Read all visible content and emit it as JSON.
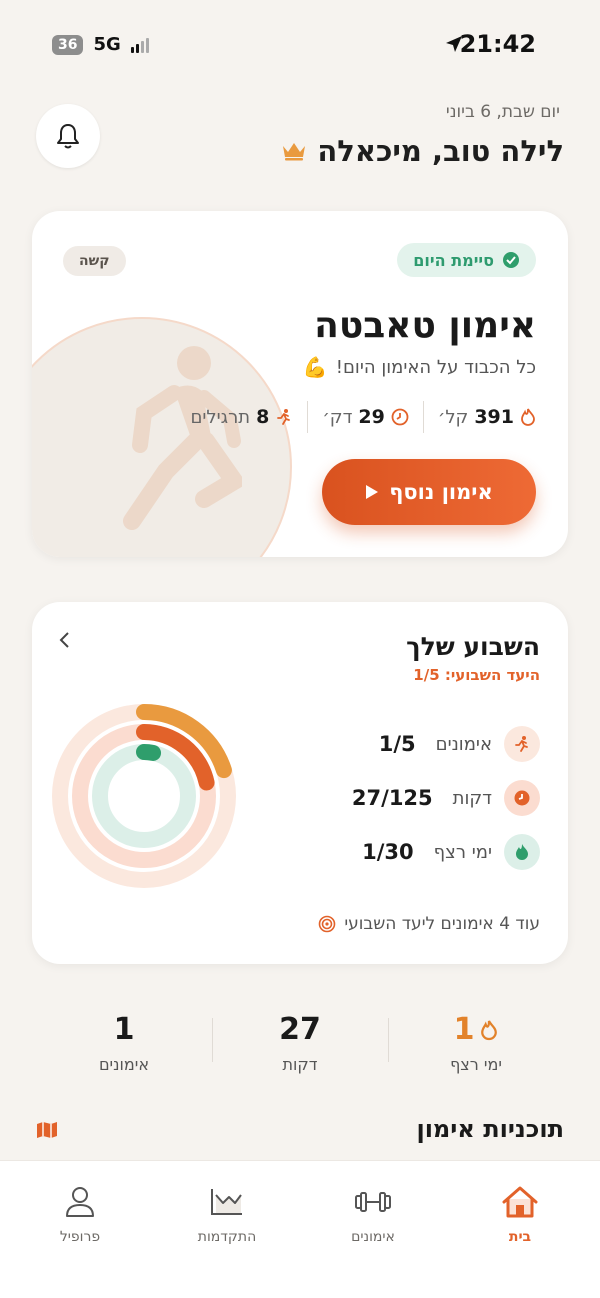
{
  "status_bar": {
    "time": "21:42",
    "network": "5G",
    "battery": "36"
  },
  "header": {
    "date": "יום שבת, 6 ביוני",
    "greeting": "לילה טוב, מיכאלה"
  },
  "workout_card": {
    "status_chip": "סיימת היום",
    "difficulty": "קשה",
    "title": "אימון טאבטה",
    "subtitle": "כל הכבוד על האימון היום!",
    "stats": [
      {
        "value": "391",
        "unit": "קל׳",
        "icon": "flame-icon"
      },
      {
        "value": "29",
        "unit": "דק׳",
        "icon": "clock-icon"
      },
      {
        "value": "8",
        "unit": "תרגילים",
        "icon": "runner-icon"
      }
    ],
    "cta_label": "אימון נוסף"
  },
  "weekly": {
    "title": "השבוע שלך",
    "goal": "היעד השבועי: 1/5",
    "rows": [
      {
        "label": "אימונים",
        "value": "1/5",
        "progress": 0.2,
        "color": "#e99a3f"
      },
      {
        "label": "דקות",
        "value": "27/125",
        "progress": 0.216,
        "color": "#e2622a"
      },
      {
        "label": "ימי רצף",
        "value": "1/30",
        "progress": 0.033,
        "color": "#2f9e6c"
      }
    ],
    "footer": "עוד 4 אימונים ליעד השבועי"
  },
  "summary": [
    {
      "value": "1",
      "label": "ימי רצף",
      "accent": true
    },
    {
      "value": "27",
      "label": "דקות",
      "accent": false
    },
    {
      "value": "1",
      "label": "אימונים",
      "accent": false
    }
  ],
  "plans": {
    "title": "תוכניות אימון"
  },
  "nav": [
    {
      "label": "בית",
      "active": true
    },
    {
      "label": "אימונים",
      "active": false
    },
    {
      "label": "התקדמות",
      "active": false
    },
    {
      "label": "פרופיל",
      "active": false
    }
  ],
  "colors": {
    "accent": "#e2622a",
    "success": "#2f9e6c",
    "background": "#f6f3ef"
  }
}
